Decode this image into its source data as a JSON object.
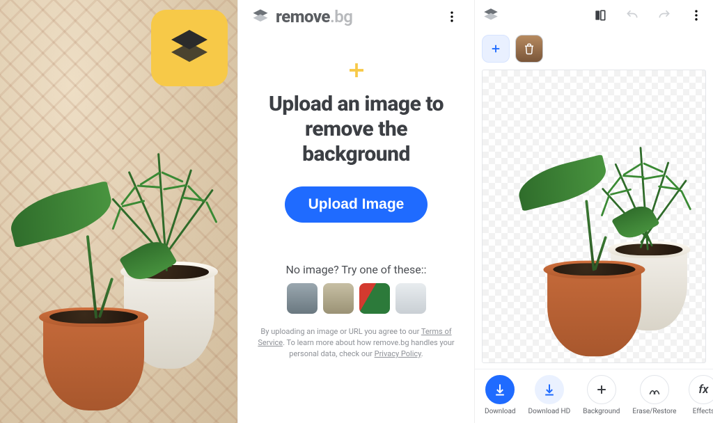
{
  "brand": {
    "strong": "remove",
    "light": ".bg"
  },
  "mid": {
    "headline": "Upload an image to remove the background",
    "upload_label": "Upload Image",
    "try_label": "No image? Try one of these::",
    "legal_pre": "By uploading an image or URL you agree to our ",
    "tos": "Terms of Service",
    "legal_mid": ". To learn more about how remove.bg handles your personal data, check our ",
    "privacy": "Privacy Policy",
    "legal_post": "."
  },
  "editor": {
    "actions": {
      "download": "Download",
      "download_hd": "Download HD",
      "background": "Background",
      "erase_restore": "Erase/Restore",
      "effects": "Effects"
    }
  }
}
